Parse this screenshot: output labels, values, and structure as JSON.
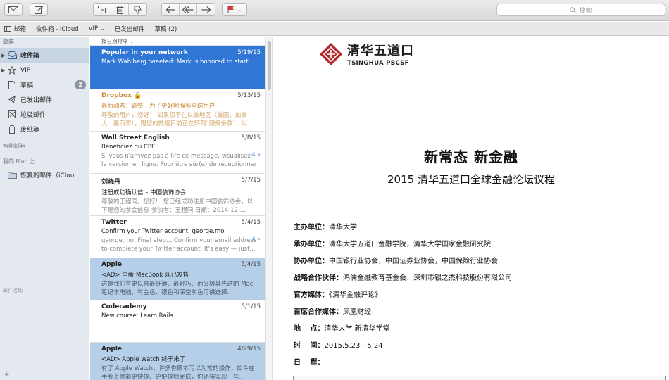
{
  "toolbar": {
    "search_placeholder": "搜索"
  },
  "favorites": {
    "mailbox": "邮箱",
    "inbox": "收件箱 - iCloud",
    "vip": "VIP ⌄",
    "sent": "已发出邮件",
    "drafts": "草稿 (2)"
  },
  "sidebar": {
    "section_mailboxes": "邮箱",
    "items": [
      {
        "label": "收件箱",
        "icon": "inbox-icon",
        "selected": true
      },
      {
        "label": "VIP",
        "icon": "star-icon"
      },
      {
        "label": "草稿",
        "icon": "document-icon",
        "badge": "2"
      },
      {
        "label": "已发出邮件",
        "icon": "paper-plane-icon"
      },
      {
        "label": "垃圾邮件",
        "icon": "junk-icon"
      },
      {
        "label": "废纸篓",
        "icon": "trash-icon"
      }
    ],
    "section_smart": "智能邮箱",
    "section_mac": "我的 Mac 上",
    "recovered": "恢复的邮件（iClou",
    "activity": "邮件活动"
  },
  "list": {
    "sort_label": "按日期排序 ⌄",
    "messages": [
      {
        "from": "Popular in your network",
        "date": "5/19/15",
        "subject": "",
        "preview": "Mark Wahlberg tweeted: Mark is honored to start...",
        "count": ""
      },
      {
        "from": "Dropbox 🔒",
        "date": "5/13/15",
        "subject": "最新动态：调整 - 为了更好地服务全球用户",
        "preview": "尊敬的用户，您好！ 如果您不在以美地区（美国、加拿大、墨西哥），则您的数据目前正在转到\"服务条款\"，以便...",
        "count": ""
      },
      {
        "from": "Wall Street English",
        "date": "5/8/15",
        "subject": "Bénéficiez du CPF !",
        "preview": "Si vous n'arrivez pas à lire ce message, visualisez la version en ligne. Pour être sûr(e) de réceptionner tous...",
        "count": "4 »"
      },
      {
        "from": "刘晓丹",
        "date": "5/7/15",
        "subject": "注册成功确认信 – 中国装饰协会",
        "preview": "尊敬的王程同，您好！ 您已经成功注册中国装饰协会，以下是您的参会信息 参加者：王程同 日期：2014-12-...",
        "count": ""
      },
      {
        "from": "Twitter",
        "date": "5/4/15",
        "subject": "Confirm your Twitter account, george.mo",
        "preview": "george.mo, Final step... Confirm your email address to complete your Twitter account. It's easy — just...",
        "count": "4 »"
      },
      {
        "from": "Apple",
        "date": "5/4/15",
        "subject": "<AD> 全新 MacBook 现已发售",
        "preview": "这是我们有史以来最纤薄、最轻巧、而又极其先进的 Mac 笔记本电脑，有金色、银色和深空灰色可供选择...",
        "count": ""
      },
      {
        "from": "Codecademy",
        "date": "5/1/15",
        "subject": "New course: Learn Rails",
        "preview": "",
        "count": ""
      },
      {
        "from": "Apple",
        "date": "4/29/15",
        "subject": "<AD> Apple Watch 终于来了",
        "preview": "有了 Apple Watch，许多你原本习以为常的操作，如今在手腕上就能更快捷、更便捷地完成，你还将实现一些...",
        "count": ""
      }
    ]
  },
  "reader": {
    "logo_cn": "清华五道口",
    "logo_en": "TSINGHUA PBCSF",
    "title": "新常态 新金融",
    "subtitle": "2015 清华五道口全球金融论坛议程",
    "rows": [
      {
        "label": "主办单位：",
        "value": "清华大学"
      },
      {
        "label": "承办单位：",
        "value": "清华大学五道口金融学院，清华大学国家金融研究院"
      },
      {
        "label": "协办单位：",
        "value": "中国银行业协会，中国证券业协会，中国保险行业协会"
      },
      {
        "label": "战略合作伙伴：",
        "value": "鸿儒金融教育基金会、深圳市银之杰科技股份有限公司"
      },
      {
        "label": "官方媒体：",
        "value": "《清华金融评论》"
      },
      {
        "label": "首席合作媒体：",
        "value": "凤凰财经"
      },
      {
        "label": "地　 点：",
        "value": "清华大学 新清华学堂"
      },
      {
        "label": "时　 间：",
        "value": "2015.5.23—5.24"
      },
      {
        "label": "日　 程：",
        "value": ""
      }
    ]
  },
  "colors": {
    "selection": "#2f76d5",
    "selection_secondary": "#b5cfe9",
    "flag": "#e0312b",
    "logo": "#b3282d"
  }
}
